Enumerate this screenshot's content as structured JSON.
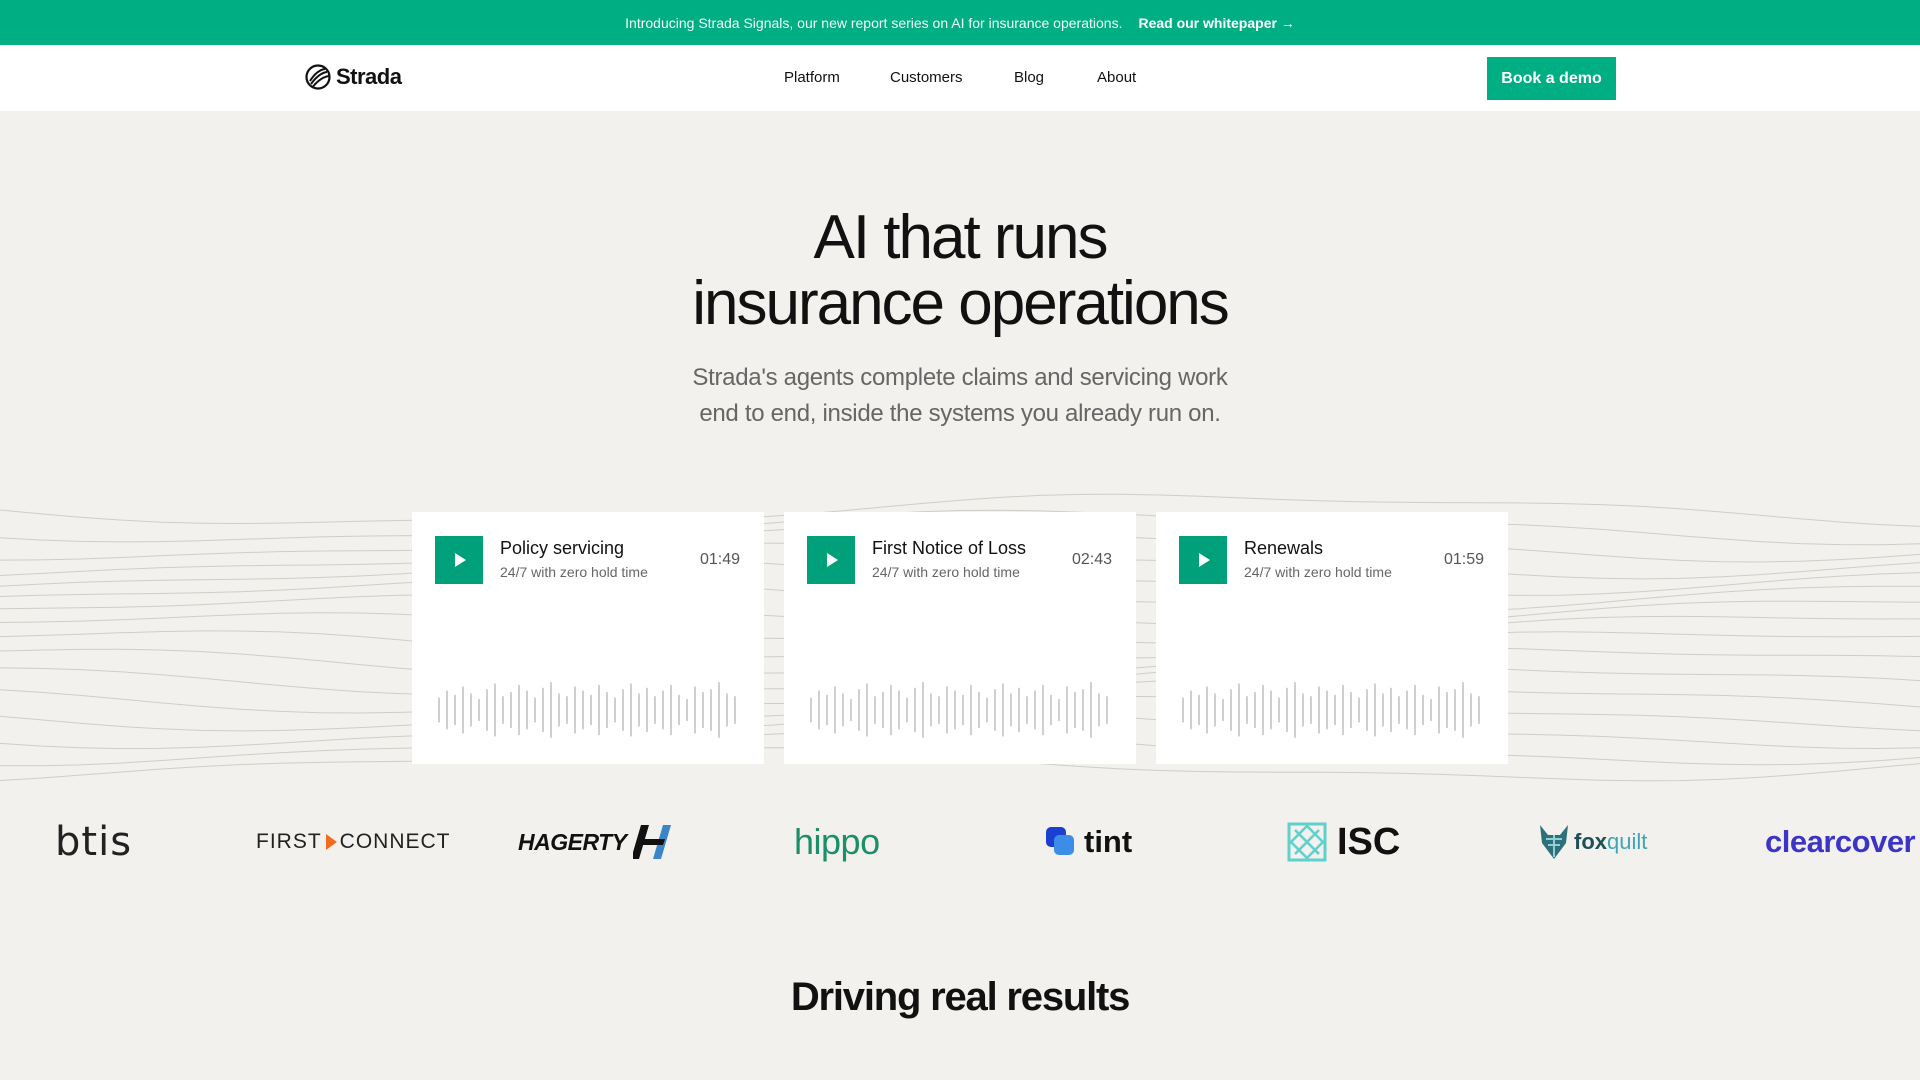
{
  "announcement": {
    "message": "Introducing Strada Signals, our new report series on AI for insurance operations.",
    "link_label": "Read our whitepaper →"
  },
  "nav": {
    "brand": "Strada",
    "links": [
      "Platform",
      "Customers",
      "Blog",
      "About"
    ],
    "cta_label": "Book a demo"
  },
  "hero": {
    "title_line1": "AI that runs",
    "title_line2": "insurance operations",
    "subtitle_line1": "Strada's agents complete claims and servicing work",
    "subtitle_line2": "end to end, inside the systems you already run on."
  },
  "demos": [
    {
      "title": "Policy servicing",
      "subtitle": "24/7 with zero hold time",
      "duration": "01:49"
    },
    {
      "title": "First Notice of Loss",
      "subtitle": "24/7 with zero hold time",
      "duration": "02:43"
    },
    {
      "title": "Renewals",
      "subtitle": "24/7 with zero hold time",
      "duration": "01:59"
    }
  ],
  "customer_logos": [
    "btis",
    "FIRST",
    "CONNECT",
    "HAGERTY",
    "hippo",
    "tint",
    "ISC",
    "fox",
    "quilt",
    "clearcover"
  ],
  "results": {
    "heading": "Driving real results"
  },
  "colors": {
    "brand_green": "#00ae83",
    "play_green": "#00a07a",
    "background": "#f2f1ee"
  }
}
